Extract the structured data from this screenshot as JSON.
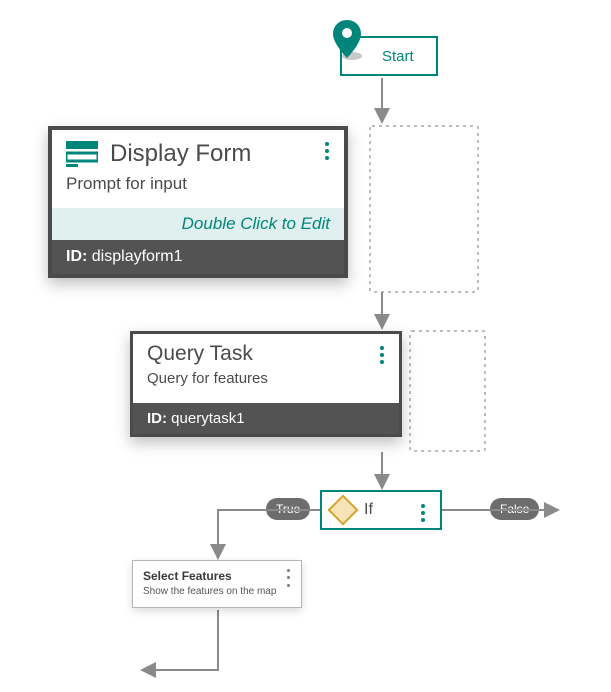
{
  "start": {
    "label": "Start"
  },
  "nodes": {
    "displayForm": {
      "title": "Display Form",
      "subtitle": "Prompt for input",
      "hint": "Double Click to Edit",
      "idLabel": "ID:",
      "id": "displayform1"
    },
    "queryTask": {
      "title": "Query Task",
      "subtitle": "Query for features",
      "idLabel": "ID:",
      "id": "querytask1"
    },
    "ifNode": {
      "label": "If",
      "trueLabel": "True",
      "falseLabel": "False"
    },
    "selectFeatures": {
      "title": "Select Features",
      "subtitle": "Show the features on the map"
    }
  }
}
